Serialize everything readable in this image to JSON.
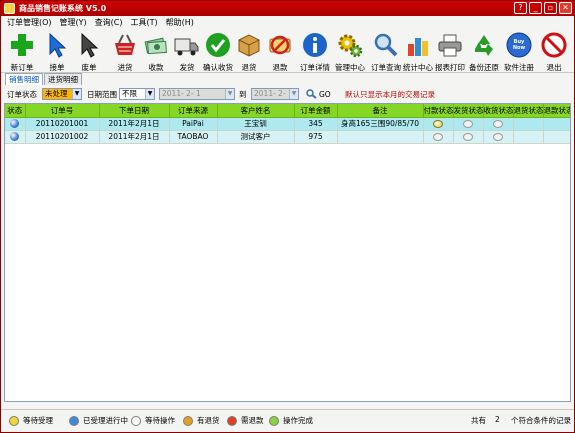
{
  "window": {
    "title": "商品销售记账系统 V5.0",
    "buttons": [
      "?",
      "_",
      "▫",
      "✕"
    ]
  },
  "menu": [
    "订单管理(O)",
    "管理(Y)",
    "查询(C)",
    "工具(T)",
    "帮助(H)"
  ],
  "toolbar": [
    {
      "label": "新订单",
      "icon": "plus-icon",
      "color": "#1aa51a"
    },
    {
      "label": "接单",
      "icon": "cursor-blue-icon",
      "color": "#1f6cd6"
    },
    {
      "label": "废单",
      "icon": "cursor-gray-icon",
      "color": "#555555"
    },
    {
      "label": "进货",
      "icon": "basket-icon",
      "color": "#cc2222"
    },
    {
      "label": "收款",
      "icon": "money-icon",
      "color": "#4aa35a"
    },
    {
      "label": "发货",
      "icon": "truck-icon",
      "color": "#777777"
    },
    {
      "label": "确认收货",
      "icon": "check-circle-icon",
      "color": "#20a020"
    },
    {
      "label": "退货",
      "icon": "box-icon",
      "color": "#c98a2a"
    },
    {
      "label": "退款",
      "icon": "no-card-icon",
      "color": "#d02020"
    },
    {
      "label": "订单详情",
      "icon": "info-icon",
      "color": "#1d63c9"
    },
    {
      "label": "管理中心",
      "icon": "gears-icon",
      "color": "#d0a000"
    },
    {
      "label": "订单查询",
      "icon": "magnifier-icon",
      "color": "#3a6fb0"
    },
    {
      "label": "统计中心",
      "icon": "bar-chart-icon",
      "color": "#2f8fd0"
    },
    {
      "label": "报表打印",
      "icon": "printer-icon",
      "color": "#888888"
    },
    {
      "label": "备份还原",
      "icon": "recycle-icon",
      "color": "#2a9a2a"
    },
    {
      "label": "软件注册",
      "icon": "buy-now-icon",
      "color": "#2b6ad3",
      "badge": "Buy Now"
    },
    {
      "label": "退出",
      "icon": "stop-icon",
      "color": "#d01010"
    }
  ],
  "tabs": [
    {
      "label": "销售明细",
      "active": true
    },
    {
      "label": "进货明细",
      "active": false
    }
  ],
  "filter": {
    "status_label": "订单状态",
    "status_value": "未处理",
    "range_label": "日期范围",
    "range_value": "不限",
    "date_from": "2011- 2- 1",
    "to_label": "到",
    "date_to": "2011- 2- 1",
    "go_label": "GO",
    "note": "默认只显示本月的交易记录"
  },
  "table": {
    "columns": [
      "状态",
      "订单号",
      "下单日期",
      "订单来源",
      "客户姓名",
      "订单金额",
      "备注",
      "付款状态",
      "发货状态",
      "收货状态",
      "退货状态",
      "退款状态"
    ],
    "rows": [
      {
        "order_no": "20110201001",
        "date": "2011年2月1日",
        "source": "PaiPai",
        "customer": "王宝钏",
        "amount": "345",
        "note": "身高165三围90/85/70",
        "paid": true
      },
      {
        "order_no": "20110201002",
        "date": "2011年2月1日",
        "source": "TAOBAO",
        "customer": "测试客户",
        "amount": "975",
        "note": "",
        "paid": false
      }
    ]
  },
  "statusbar": {
    "legend": [
      {
        "label": "等待受理",
        "color": "#f2d23a"
      },
      {
        "label": "已受理进行中",
        "color": "#3c8be0"
      },
      {
        "label": "等待操作",
        "color": "#ffffff"
      },
      {
        "label": "有退货",
        "color": "#e0a020"
      },
      {
        "label": "需退款",
        "color": "#e04020"
      },
      {
        "label": "操作完成",
        "color": "#8bd23a"
      }
    ],
    "total_prefix": "共有",
    "total_count": "2",
    "total_suffix": "个符合条件的记录"
  }
}
